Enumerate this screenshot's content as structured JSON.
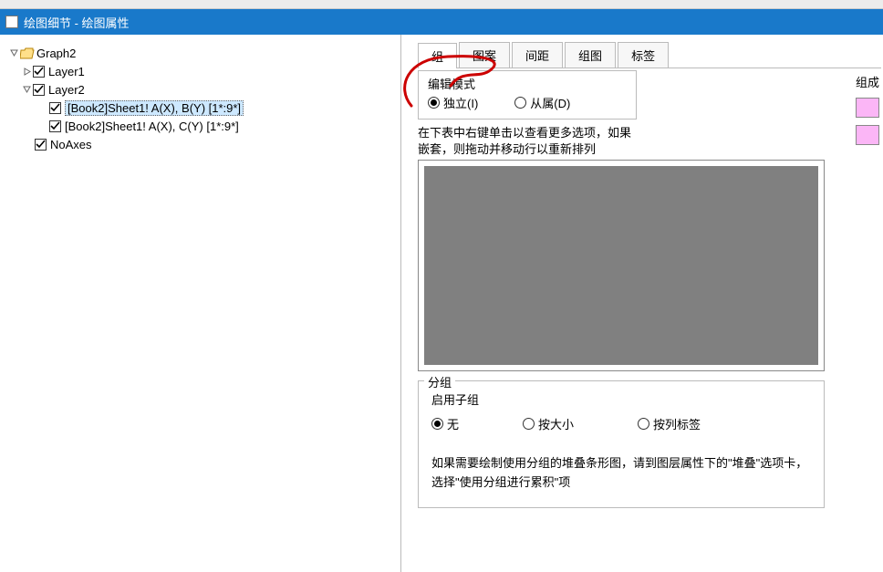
{
  "menubar_text": "",
  "title": "绘图细节 - 绘图属性",
  "tree": {
    "root": "Graph2",
    "layer1": "Layer1",
    "layer2": "Layer2",
    "item1": "[Book2]Sheet1! A(X), B(Y) [1*:9*]",
    "item2": "[Book2]Sheet1! A(X), C(Y) [1*:9*]",
    "noaxes": "NoAxes"
  },
  "tabs": {
    "group": "组",
    "pattern": "图案",
    "spacing": "间距",
    "group_graph": "组图",
    "label": "标签"
  },
  "edit_mode": {
    "legend": "编辑模式",
    "independent": "独立(I)",
    "dependent": "从属(D)"
  },
  "hint": {
    "line1": "在下表中右键单击以查看更多选项，如果",
    "line2": "嵌套，则拖动并移动行以重新排列"
  },
  "subgroup": {
    "legend": "分组",
    "enable": "启用子组",
    "none": "无",
    "by_size": "按大小",
    "by_col_label": "按列标签"
  },
  "note": "如果需要绘制使用分组的堆叠条形图，请到图层属性下的\"堆叠\"选项卡，选择\"使用分组进行累积\"项",
  "member": {
    "title": "组成"
  }
}
